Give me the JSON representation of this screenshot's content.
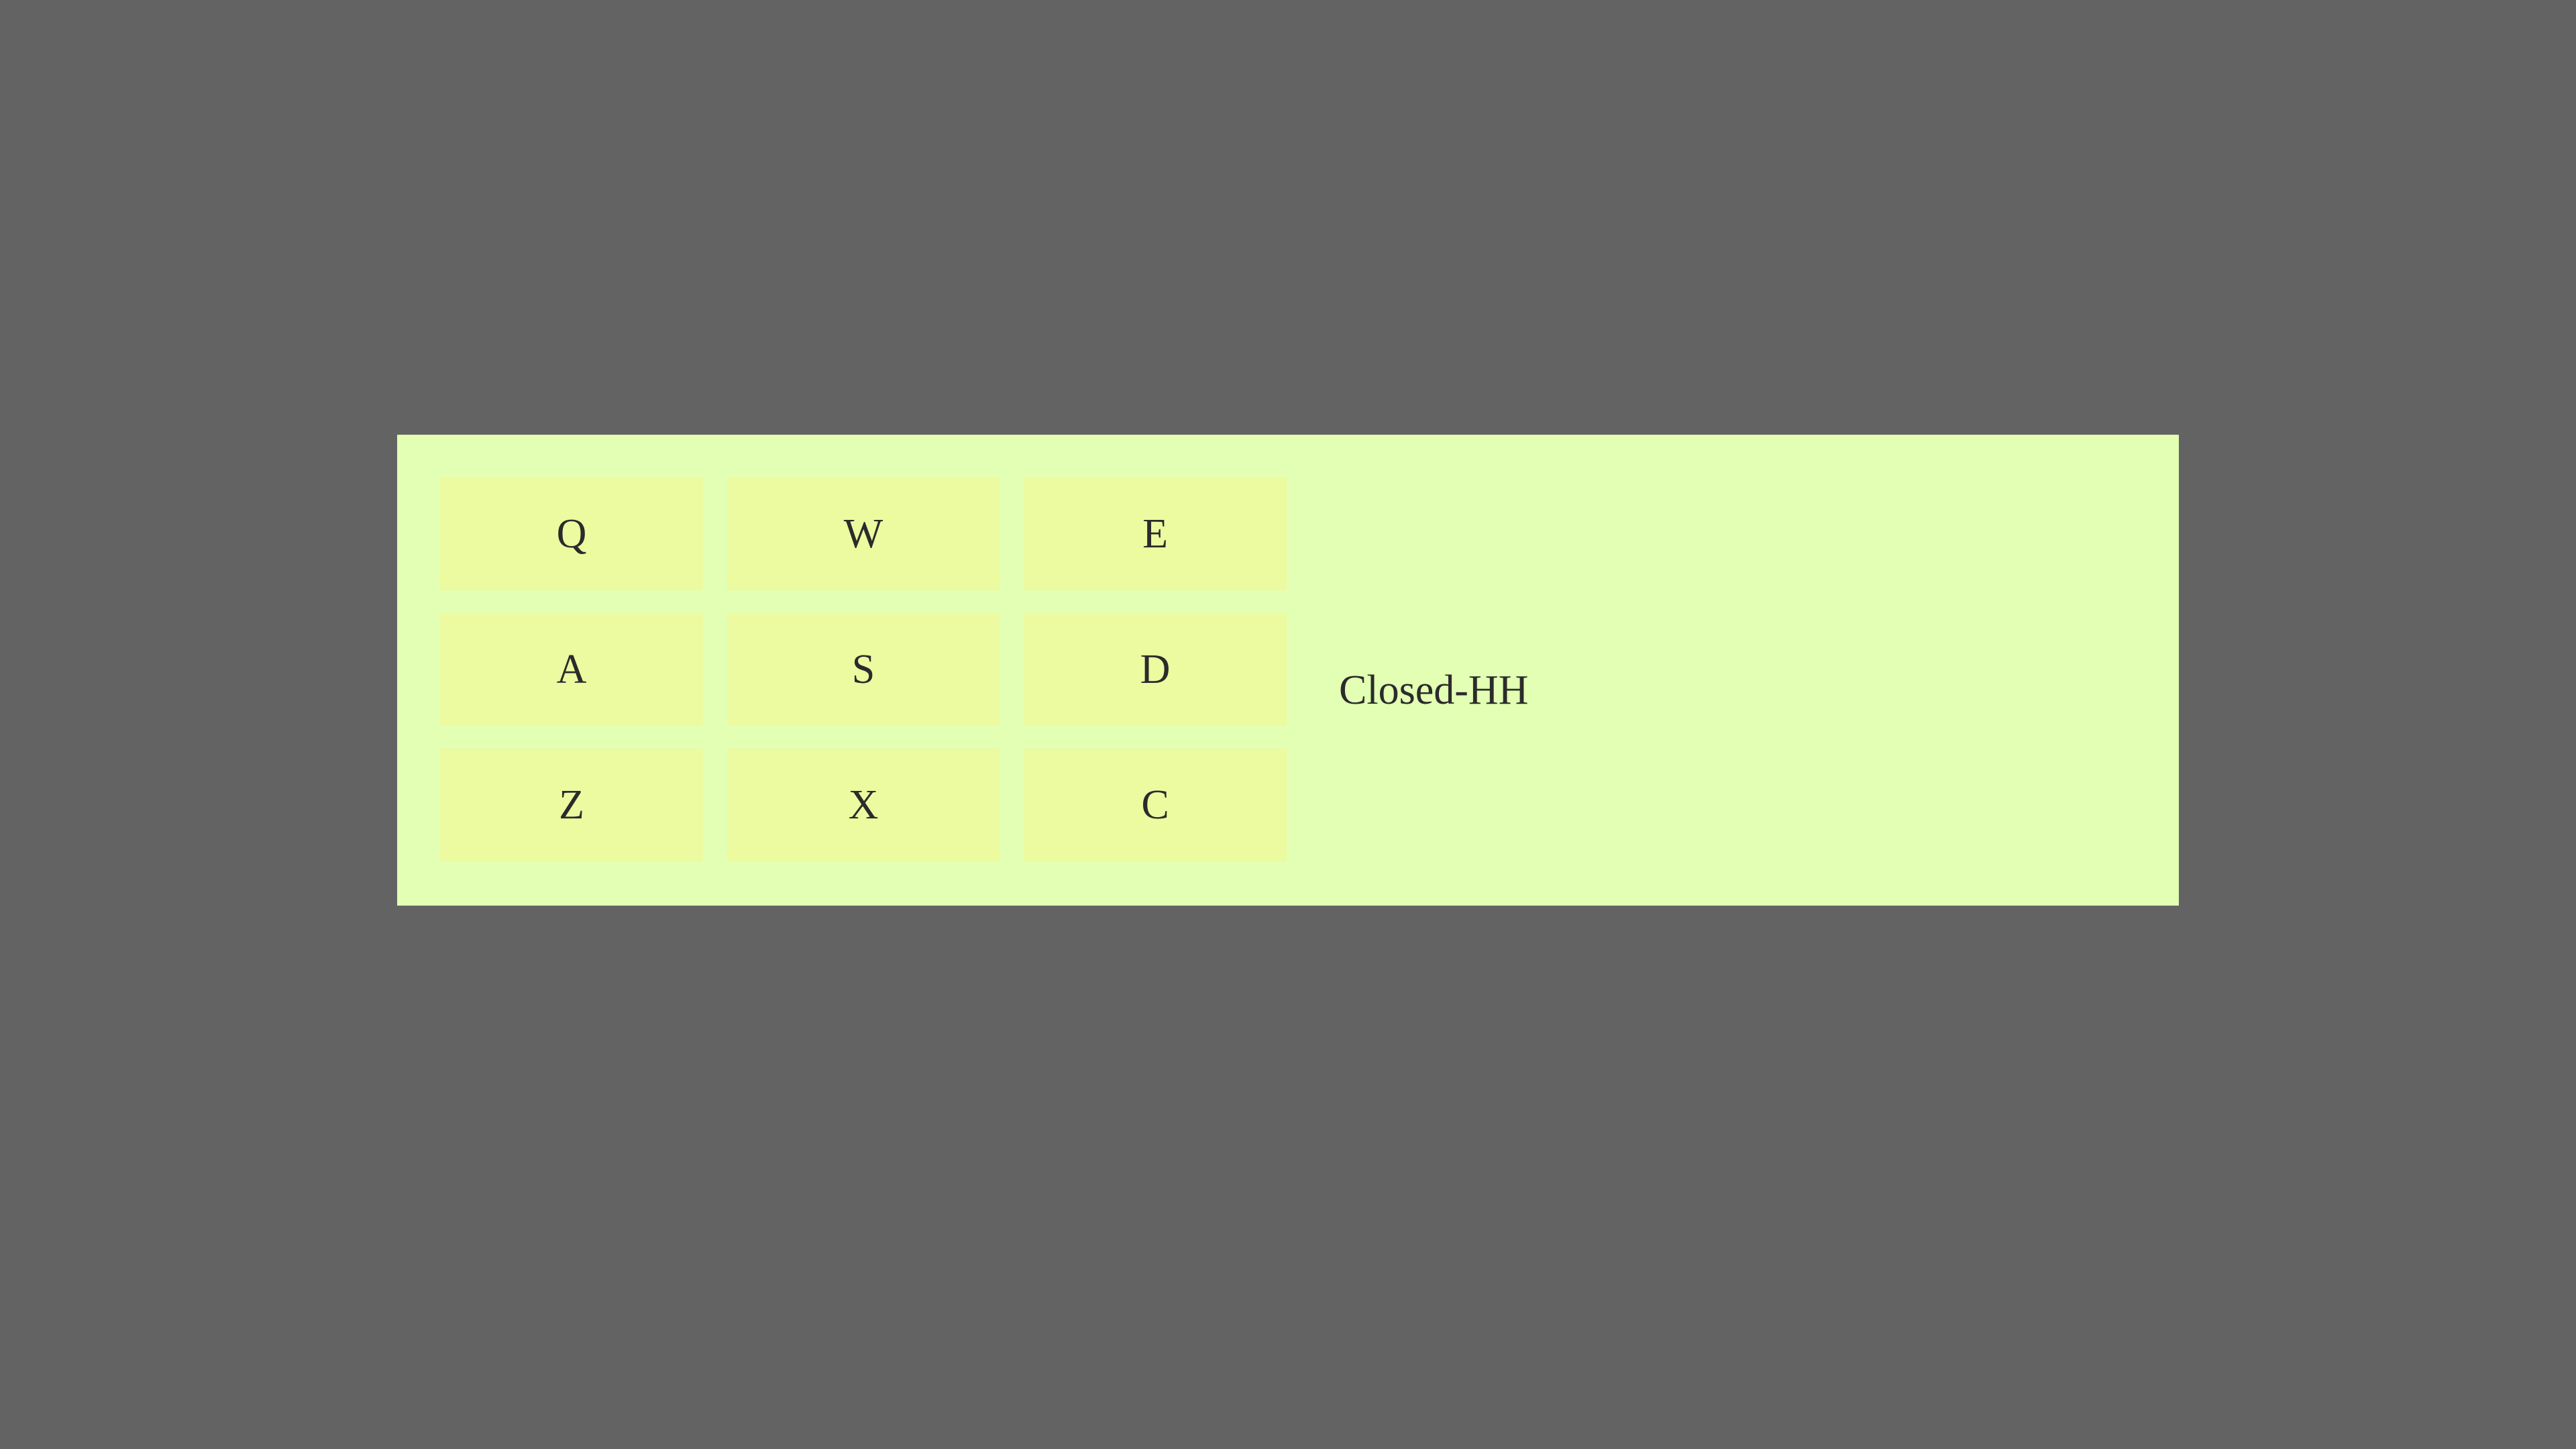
{
  "keypad": {
    "keys": [
      {
        "label": "Q"
      },
      {
        "label": "W"
      },
      {
        "label": "E"
      },
      {
        "label": "A"
      },
      {
        "label": "S"
      },
      {
        "label": "D"
      },
      {
        "label": "Z"
      },
      {
        "label": "X"
      },
      {
        "label": "C"
      }
    ]
  },
  "status": {
    "text": "Closed-HH"
  },
  "colors": {
    "background": "#636363",
    "panel": "#e2ffb4",
    "key": "#ecfaa0",
    "text": "#2b2b2b"
  }
}
